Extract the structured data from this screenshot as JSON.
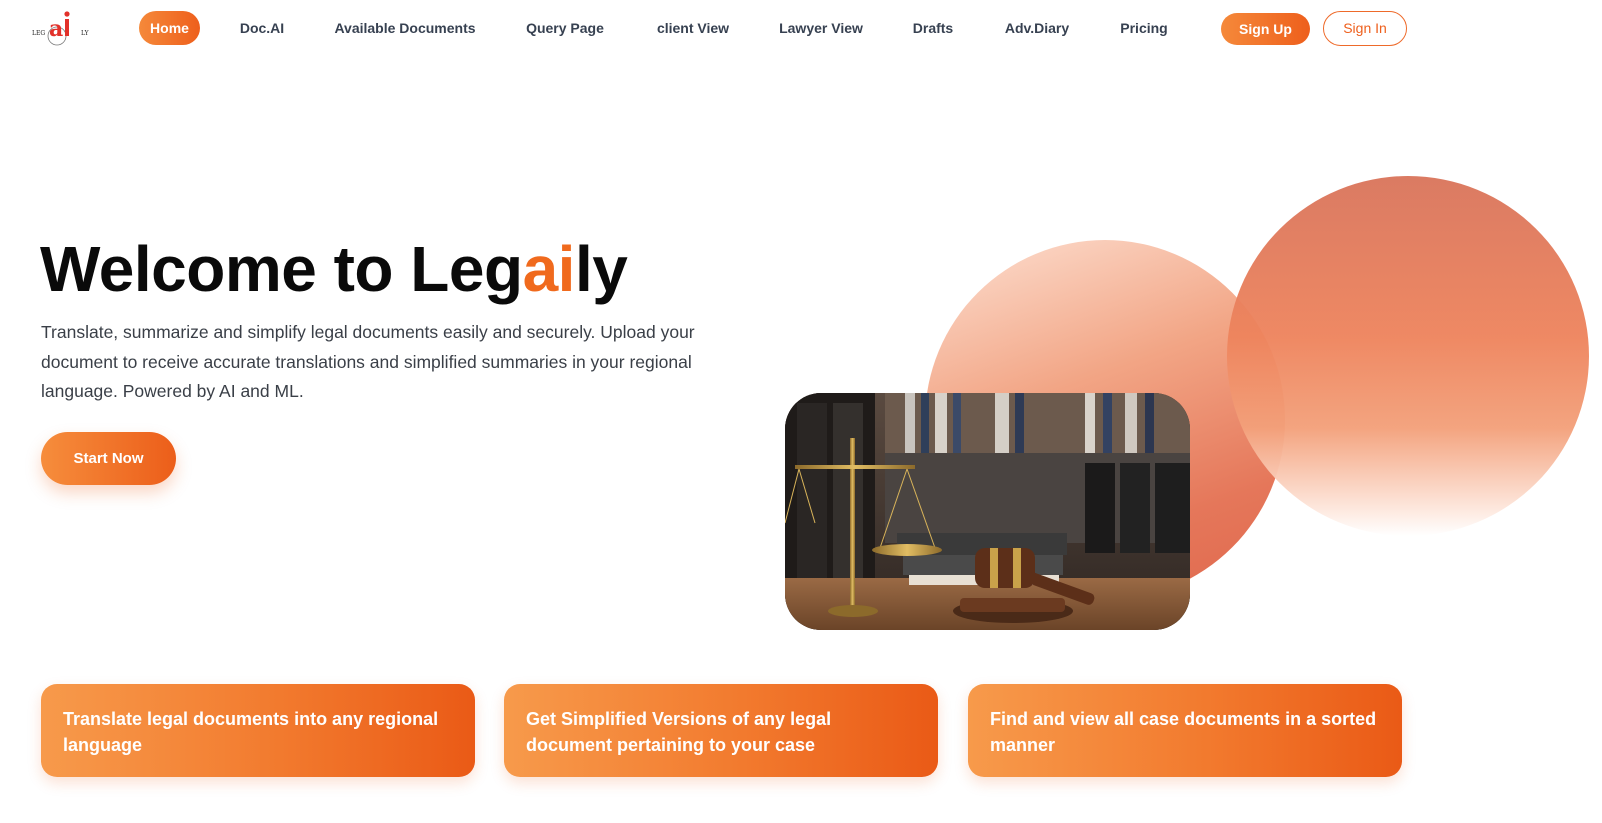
{
  "brand": {
    "logo_left": "LEG",
    "logo_mid": "ai",
    "logo_right": "LY"
  },
  "nav": {
    "items": [
      {
        "label": "Home",
        "active": true
      },
      {
        "label": "Doc.AI",
        "active": false
      },
      {
        "label": "Available Documents",
        "active": false
      },
      {
        "label": "Query Page",
        "active": false
      },
      {
        "label": "client View",
        "active": false
      },
      {
        "label": "Lawyer View",
        "active": false
      },
      {
        "label": "Drafts",
        "active": false
      },
      {
        "label": "Adv.Diary",
        "active": false
      },
      {
        "label": "Pricing",
        "active": false
      }
    ],
    "sign_up": "Sign Up",
    "sign_in": "Sign In"
  },
  "hero": {
    "title_prefix": "Welcome to Leg",
    "title_accent": "ai",
    "title_suffix": "ly",
    "description": "Translate, summarize and simplify legal documents easily and securely. Upload your document to receive accurate translations and simplified summaries in your regional language. Powered by AI and ML.",
    "cta": "Start Now"
  },
  "features": [
    {
      "text": "Translate legal documents into any regional language"
    },
    {
      "text": "Get Simplified Versions of any legal document pertaining to your case"
    },
    {
      "text": "Find and view all case documents in a sorted manner"
    }
  ],
  "colors": {
    "accent": "#f06a1d",
    "accent_light": "#f68d3c",
    "text_dark": "#0a0a0a",
    "text_body": "#3a3f47"
  }
}
